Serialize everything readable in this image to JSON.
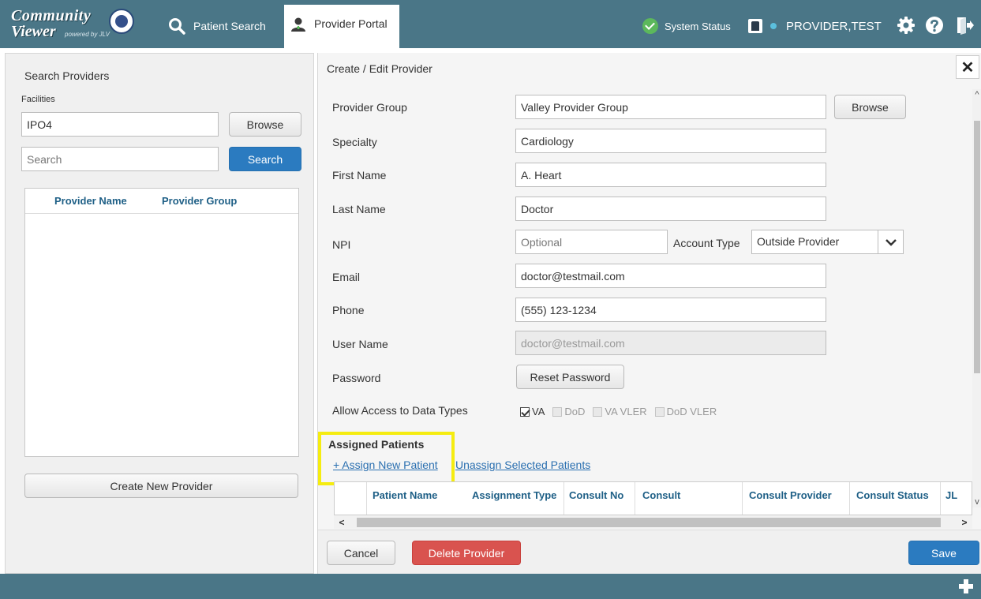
{
  "app": {
    "logo_line1": "Community",
    "logo_line2": "Viewer",
    "logo_powered": "powered by JLV"
  },
  "nav": {
    "patient_search": "Patient Search",
    "provider_portal": "Provider Portal"
  },
  "header": {
    "system_status": "System Status",
    "user": "PROVIDER,TEST"
  },
  "search_panel": {
    "title": "Search Providers",
    "facilities_label": "Facilities",
    "facilities_value": "IPO4",
    "browse_label": "Browse",
    "search_placeholder": "Search",
    "search_button": "Search",
    "columns": [
      "Provider Name",
      "Provider Group"
    ],
    "create_button": "Create New Provider"
  },
  "edit_panel": {
    "title": "Create / Edit Provider",
    "fields": {
      "provider_group": {
        "label": "Provider Group",
        "value": "Valley Provider Group"
      },
      "specialty": {
        "label": "Specialty",
        "value": "Cardiology"
      },
      "first_name": {
        "label": "First Name",
        "value": "A. Heart"
      },
      "last_name": {
        "label": "Last Name",
        "value": "Doctor"
      },
      "npi": {
        "label": "NPI",
        "placeholder": "Optional"
      },
      "account_type": {
        "label": "Account Type",
        "value": "Outside Provider"
      },
      "email": {
        "label": "Email",
        "value": "doctor@testmail.com"
      },
      "phone": {
        "label": "Phone",
        "value": "(555) 123-1234"
      },
      "user_name": {
        "label": "User Name",
        "value": "doctor@testmail.com"
      },
      "password": {
        "label": "Password",
        "button": "Reset Password"
      },
      "data_types": {
        "label": "Allow Access to Data Types",
        "options": [
          {
            "label": "VA",
            "checked": true
          },
          {
            "label": "DoD",
            "checked": false
          },
          {
            "label": "VA VLER",
            "checked": false
          },
          {
            "label": "DoD VLER",
            "checked": false
          }
        ]
      }
    },
    "browse_label": "Browse",
    "assigned": {
      "title": "Assigned Patients",
      "assign_link": "+ Assign New Patient",
      "unassign_link": "Unassign Selected Patients",
      "columns": [
        "Patient Name",
        "Assignment Type",
        "Consult No",
        "Consult",
        "Consult Provider",
        "Consult Status",
        "JL"
      ]
    },
    "footer": {
      "cancel": "Cancel",
      "delete": "Delete Provider",
      "save": "Save"
    }
  },
  "colors": {
    "header_bg": "#4a7687",
    "primary": "#2b7bc0",
    "danger": "#d9534f",
    "highlight": "#f5ec10",
    "table_header_text": "#1e5f86"
  }
}
